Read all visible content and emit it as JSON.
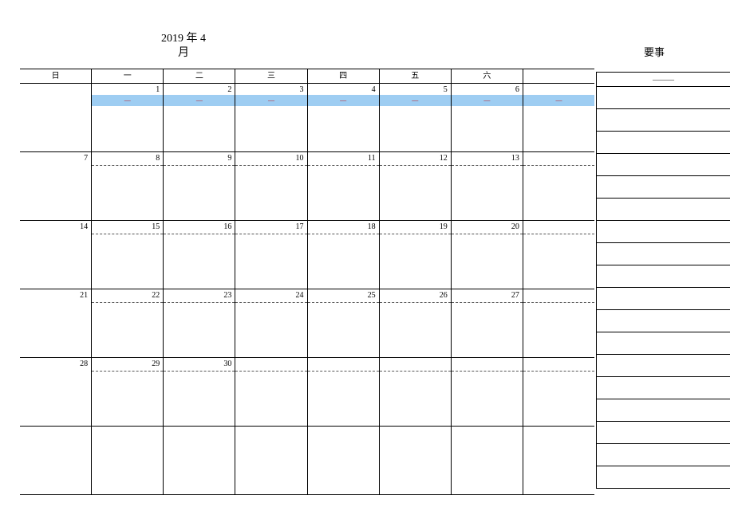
{
  "title_line1": "2019 年 4",
  "title_line2": "月",
  "notes_title": "要事",
  "notes_header": "———",
  "weekdays": [
    "日",
    "一",
    "二",
    "三",
    "四",
    "五",
    "六",
    ""
  ],
  "weeks": [
    {
      "dates": [
        "",
        "1",
        "2",
        "3",
        "4",
        "5",
        "6",
        ""
      ],
      "highlight": true
    },
    {
      "dates": [
        "7",
        "8",
        "9",
        "10",
        "11",
        "12",
        "13",
        ""
      ],
      "highlight": false
    },
    {
      "dates": [
        "14",
        "15",
        "16",
        "17",
        "18",
        "19",
        "20",
        ""
      ],
      "highlight": false
    },
    {
      "dates": [
        "21",
        "22",
        "23",
        "24",
        "25",
        "26",
        "27",
        ""
      ],
      "highlight": false
    },
    {
      "dates": [
        "28",
        "29",
        "30",
        "",
        "",
        "",
        "",
        ""
      ],
      "highlight": false
    },
    {
      "dates": [
        "",
        "",
        "",
        "",
        "",
        "",
        "",
        ""
      ],
      "highlight": false
    }
  ],
  "strip_text": "—",
  "note_lines": 18
}
